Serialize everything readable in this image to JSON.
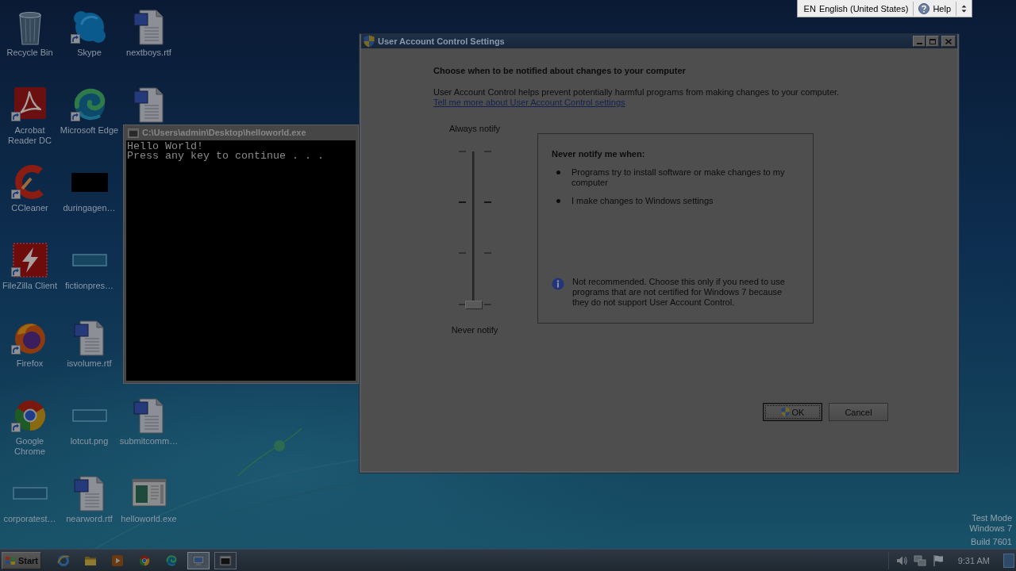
{
  "desktop": {
    "rows": [
      [
        {
          "label": "Recycle Bin",
          "kind": "recycle-bin",
          "shortcut": false
        },
        {
          "label": "Skype",
          "kind": "skype",
          "shortcut": true
        },
        {
          "label": "nextboys.rtf",
          "kind": "word-doc",
          "shortcut": false
        }
      ],
      [
        {
          "label": "Acrobat Reader DC",
          "kind": "acrobat",
          "shortcut": true
        },
        {
          "label": "Microsoft Edge",
          "kind": "edge",
          "shortcut": true
        },
        {
          "kind": "word-doc",
          "shortcut": false
        }
      ],
      [
        {
          "label": "CCleaner",
          "kind": "ccleaner",
          "shortcut": true
        },
        {
          "label": "duringagen…",
          "kind": "black-thumb",
          "shortcut": false
        }
      ],
      [
        {
          "label": "FileZilla Client",
          "kind": "filezilla",
          "shortcut": true
        },
        {
          "label": "fictionpres…",
          "kind": "blank-file",
          "shortcut": false
        }
      ],
      [
        {
          "label": "Firefox",
          "kind": "firefox",
          "shortcut": true
        },
        {
          "label": "isvolume.rtf",
          "kind": "word-doc",
          "shortcut": false
        }
      ],
      [
        {
          "label": "Google Chrome",
          "kind": "chrome",
          "shortcut": true
        },
        {
          "label": "lotcut.png",
          "kind": "blank-file",
          "shortcut": false
        },
        {
          "label": "submitcomm…",
          "kind": "word-doc",
          "shortcut": false
        }
      ],
      [
        {
          "label": "corporatest…",
          "kind": "blank-file",
          "shortcut": false
        },
        {
          "label": "nearword.rtf",
          "kind": "word-doc",
          "shortcut": false
        },
        {
          "label": "helloworld.exe",
          "kind": "exe",
          "shortcut": false
        }
      ]
    ],
    "system_notice": [
      "Test Mode",
      "Windows 7",
      "Build 7601"
    ]
  },
  "language_bar": {
    "code": "EN",
    "language": "English (United States)",
    "help": "Help"
  },
  "console_window": {
    "title": "C:\\Users\\admin\\Desktop\\helloworld.exe",
    "lines": [
      "Hello World!",
      "Press any key to continue . . ."
    ]
  },
  "uac_window": {
    "title": "User Account Control Settings",
    "heading": "Choose when to be notified about changes to your computer",
    "description": "User Account Control helps prevent potentially harmful programs from making changes to your computer.",
    "link": "Tell me more about User Account Control settings",
    "slider": {
      "top_label": "Always notify",
      "bottom_label": "Never notify",
      "level": 0
    },
    "panel": {
      "heading": "Never notify me when:",
      "bullets": [
        "Programs try to install software or make changes to my computer",
        "I make changes to Windows settings"
      ],
      "note": "Not recommended. Choose this only if you need to use programs that are not certified for Windows 7 because they do not support User Account Control."
    },
    "buttons": [
      {
        "label": "OK",
        "shield": true,
        "focused": true
      },
      {
        "label": "Cancel",
        "shield": false,
        "focused": false
      }
    ]
  },
  "taskbar": {
    "start": "Start",
    "apps": [
      {
        "kind": "ie",
        "open": false,
        "active": false
      },
      {
        "kind": "folder",
        "open": false,
        "active": false
      },
      {
        "kind": "media",
        "open": false,
        "active": false
      },
      {
        "kind": "chrome",
        "open": false,
        "active": false
      },
      {
        "kind": "edge",
        "open": false,
        "active": false
      },
      {
        "kind": "monitor",
        "open": true,
        "active": true
      },
      {
        "kind": "console",
        "open": true,
        "active": false
      }
    ],
    "clock": "9:31 AM"
  }
}
